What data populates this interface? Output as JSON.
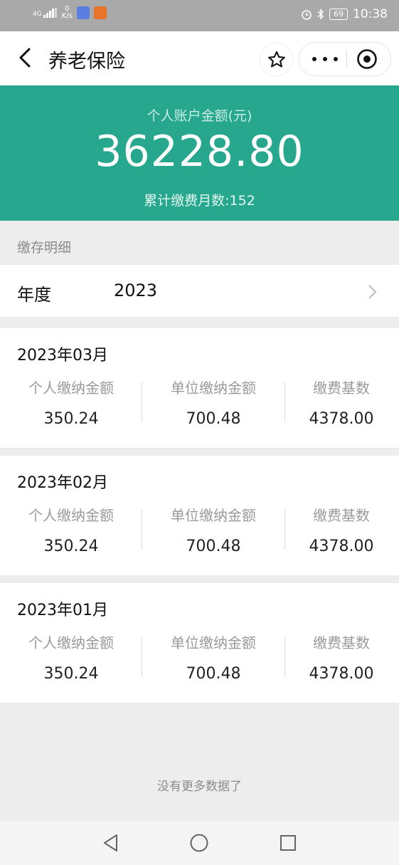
{
  "status_bar": {
    "network": "4G",
    "speed_value": "0",
    "speed_unit": "K/s",
    "battery": "69",
    "time": "10:38",
    "icons": [
      "signal-icon",
      "app-badge-icon",
      "app-badge-icon",
      "alarm-icon",
      "bluetooth-icon",
      "battery-icon"
    ]
  },
  "navbar": {
    "title": "养老保险",
    "icons": [
      "back-arrow-icon",
      "star-icon",
      "more-dots-icon",
      "target-icon"
    ]
  },
  "summary": {
    "label": "个人账户金额(元)",
    "amount": "36228.80",
    "months": "累计缴费月数:152"
  },
  "section_title": "缴存明细",
  "year_selector": {
    "label": "年度",
    "value": "2023"
  },
  "columns": {
    "personal": "个人缴纳金额",
    "employer": "单位缴纳金额",
    "base": "缴费基数"
  },
  "records": [
    {
      "month": "2023年03月",
      "personal": "350.24",
      "employer": "700.48",
      "base": "4378.00"
    },
    {
      "month": "2023年02月",
      "personal": "350.24",
      "employer": "700.48",
      "base": "4378.00"
    },
    {
      "month": "2023年01月",
      "personal": "350.24",
      "employer": "700.48",
      "base": "4378.00"
    }
  ],
  "footer_text": "没有更多数据了",
  "colors": {
    "accent": "#27a78d",
    "status_bar": "#a9a9a9",
    "background": "#ededed"
  }
}
